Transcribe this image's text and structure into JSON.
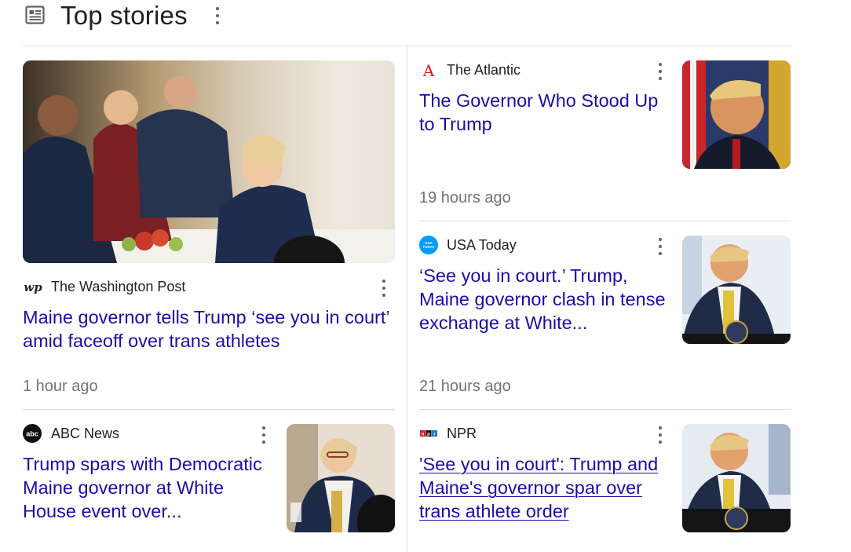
{
  "header": {
    "title": "Top stories"
  },
  "stories": [
    {
      "source": "The Washington Post",
      "headline": "Maine governor tells Trump ‘see you in court’ amid faceoff over trans athletes",
      "time": "1 hour ago",
      "logo_text": "wp"
    },
    {
      "source": "The Atlantic",
      "headline": "The Governor Who Stood Up to Trump",
      "time": "19 hours ago",
      "logo_text": "A"
    },
    {
      "source": "USA Today",
      "headline": "‘See you in court.’ Trump, Maine governor clash in tense exchange at White...",
      "time": "21 hours ago",
      "logo_text": "USA TODAY"
    },
    {
      "source": "ABC News",
      "headline": "Trump spars with Democratic Maine governor at White House event over...",
      "logo_text": "abc"
    },
    {
      "source": "NPR",
      "headline": "'See you in court': Trump and Maine's governor spar over trans athlete order",
      "logo_text": "NPR"
    }
  ],
  "colors": {
    "link": "#1a0dab",
    "meta": "#70757a",
    "divider": "#dadce0",
    "usa_today": "#009bff",
    "npr_red": "#d62021",
    "npr_blue": "#237bbd",
    "atlantic_red": "#e7131a"
  }
}
